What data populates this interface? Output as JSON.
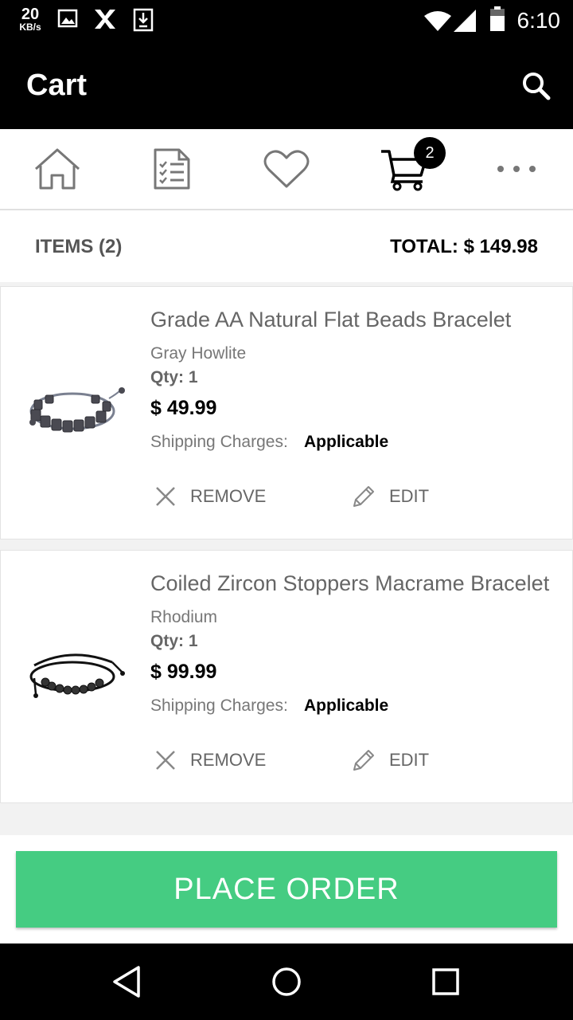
{
  "status_bar": {
    "speed_value": "20",
    "speed_unit": "KB/s",
    "time": "6:10"
  },
  "appbar": {
    "title": "Cart",
    "search_icon": "search-icon"
  },
  "nav": {
    "icons": [
      "home-icon",
      "orders-list-icon",
      "wishlist-heart-icon",
      "cart-icon",
      "more-dots-icon"
    ],
    "cart_badge": "2"
  },
  "summary": {
    "items_label": "ITEMS (2)",
    "total_label": "TOTAL: $ 149.98"
  },
  "cart_items": [
    {
      "name": "Grade AA Natural Flat Beads Bracelet",
      "variant": "Gray Howlite",
      "qty": "Qty: 1",
      "price": "$ 49.99",
      "shipping_label": "Shipping Charges:",
      "shipping_value": "Applicable",
      "remove_label": "REMOVE",
      "edit_label": "EDIT"
    },
    {
      "name": "Coiled Zircon Stoppers Macrame Bracelet",
      "variant": "Rhodium",
      "qty": "Qty: 1",
      "price": "$ 99.99",
      "shipping_label": "Shipping Charges:",
      "shipping_value": "Applicable",
      "remove_label": "REMOVE",
      "edit_label": "EDIT"
    }
  ],
  "place_order_label": "PLACE ORDER",
  "colors": {
    "accent": "#45cc82",
    "header": "#000000"
  }
}
